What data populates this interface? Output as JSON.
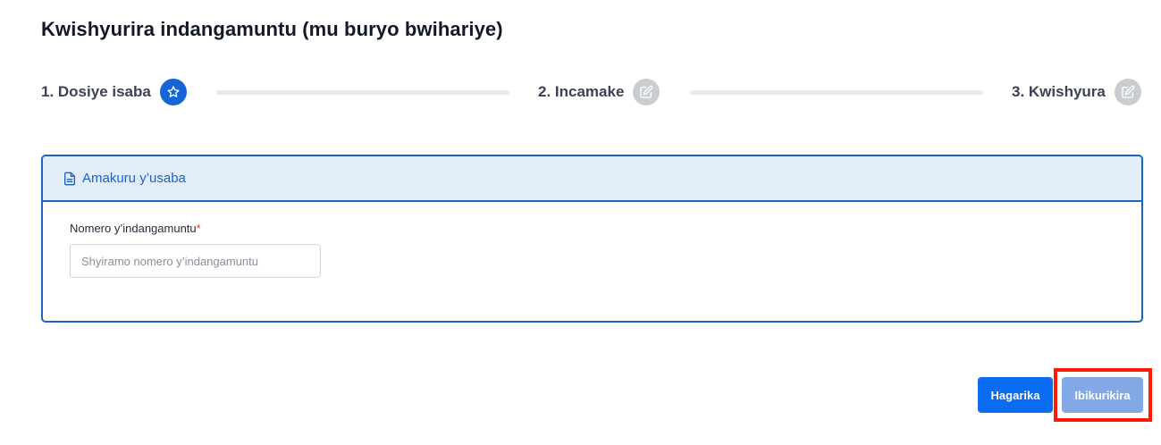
{
  "page": {
    "title": "Kwishyurira indangamuntu (mu buryo bwihariye)"
  },
  "stepper": {
    "steps": [
      {
        "label": "1. Dosiye isaba",
        "icon": "star-icon",
        "state": "active"
      },
      {
        "label": "2. Incamake",
        "icon": "edit-icon",
        "state": "inactive"
      },
      {
        "label": "3. Kwishyura",
        "icon": "edit-icon",
        "state": "inactive"
      }
    ]
  },
  "card": {
    "header_icon": "document-icon",
    "title": "Amakuru y’usaba",
    "field": {
      "label": "Nomero y’indangamuntu",
      "required_mark": "*",
      "value": "",
      "placeholder": "Shyiramo nomero y’indangamuntu"
    }
  },
  "actions": {
    "cancel_label": "Hagarika",
    "next_label": "Ibikurikira"
  },
  "colors": {
    "primary": "#0a6cf0",
    "primary_disabled": "#82a8e6",
    "card_border": "#1b63c4",
    "card_header_bg": "#e2edf9",
    "step_inactive": "#c9ccd1",
    "highlight": "#ff1a0a"
  }
}
